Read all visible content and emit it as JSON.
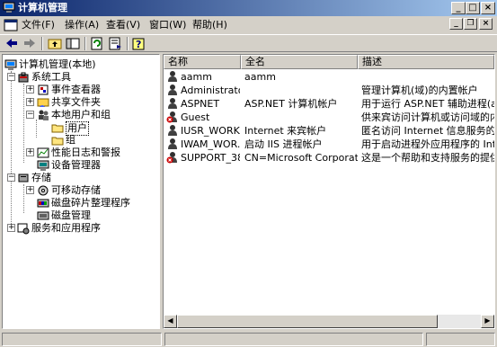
{
  "window": {
    "title": "计算机管理"
  },
  "menu": [
    "文件(F)",
    "操作(A)",
    "查看(V)",
    "窗口(W)",
    "帮助(H)"
  ],
  "tree": [
    {
      "label": "计算机管理(本地)",
      "icon": "computer-management-icon"
    },
    {
      "label": "系统工具",
      "icon": "system-tools-icon"
    },
    {
      "label": "事件查看器",
      "icon": "event-viewer-icon"
    },
    {
      "label": "共享文件夹",
      "icon": "shared-folders-icon"
    },
    {
      "label": "本地用户和组",
      "icon": "local-users-groups-icon"
    },
    {
      "label": "用户",
      "icon": "folder-icon"
    },
    {
      "label": "组",
      "icon": "folder-icon"
    },
    {
      "label": "性能日志和警报",
      "icon": "performance-logs-icon"
    },
    {
      "label": "设备管理器",
      "icon": "device-manager-icon"
    },
    {
      "label": "存储",
      "icon": "storage-icon"
    },
    {
      "label": "可移动存储",
      "icon": "removable-storage-icon"
    },
    {
      "label": "磁盘碎片整理程序",
      "icon": "disk-defrag-icon"
    },
    {
      "label": "磁盘管理",
      "icon": "disk-management-icon"
    },
    {
      "label": "服务和应用程序",
      "icon": "services-apps-icon"
    }
  ],
  "list": {
    "headers": [
      "名称",
      "全名",
      "描述"
    ],
    "rows": [
      {
        "name": "aamm",
        "full": "aamm",
        "desc": "",
        "disabled": false
      },
      {
        "name": "Administrator",
        "full": "",
        "desc": "管理计算机(域)的内置帐户",
        "disabled": false
      },
      {
        "name": "ASPNET",
        "full": "ASP.NET 计算机帐户",
        "desc": "用于运行 ASP.NET 辅助进程(aspr",
        "disabled": false
      },
      {
        "name": "Guest",
        "full": "",
        "desc": "供来宾访问计算机或访问域的内",
        "disabled": true
      },
      {
        "name": "IUSR_WORK...",
        "full": "Internet 来宾帐户",
        "desc": "匿名访问 Internet 信息服务的内",
        "disabled": false
      },
      {
        "name": "IWAM_WOR...",
        "full": "启动 IIS 进程帐户",
        "desc": "用于启动进程外应用程序的 Inte",
        "disabled": false
      },
      {
        "name": "SUPPORT_38...",
        "full": "CN=Microsoft Corporation...",
        "desc": "这是一个帮助和支持服务的提供",
        "disabled": true
      }
    ]
  },
  "colors": {
    "titlebar_start": "#0a246a",
    "titlebar_end": "#a6caf0",
    "face": "#d4d0c8",
    "disabled_x": "#cc0000"
  }
}
